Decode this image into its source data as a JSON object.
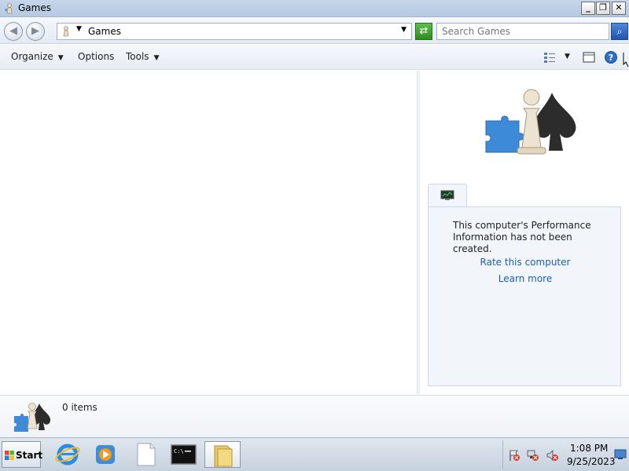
{
  "window": {
    "title": "Games"
  },
  "address_bar": {
    "breadcrumb": "Games",
    "search_placeholder": "Search Games"
  },
  "toolbar": {
    "organize_label": "Organize",
    "options_label": "Options",
    "tools_label": "Tools"
  },
  "performance": {
    "message": "This computer's Performance Information has not been created.",
    "rate_link": "Rate this computer",
    "learn_link": "Learn more"
  },
  "details": {
    "item_count": "0 items"
  },
  "taskbar": {
    "start_label": "Start",
    "clock_time": "1:08 PM",
    "clock_date": "9/25/2023"
  },
  "icons": {
    "app": "games-icon",
    "back": "back-arrow-icon",
    "forward": "forward-arrow-icon",
    "refresh": "refresh-icon",
    "search": "search-icon",
    "views": "views-icon",
    "preview_pane": "preview-pane-icon",
    "help": "help-icon"
  },
  "colors": {
    "link": "#1a5fb4",
    "titlebar": "#c6d6ea"
  }
}
